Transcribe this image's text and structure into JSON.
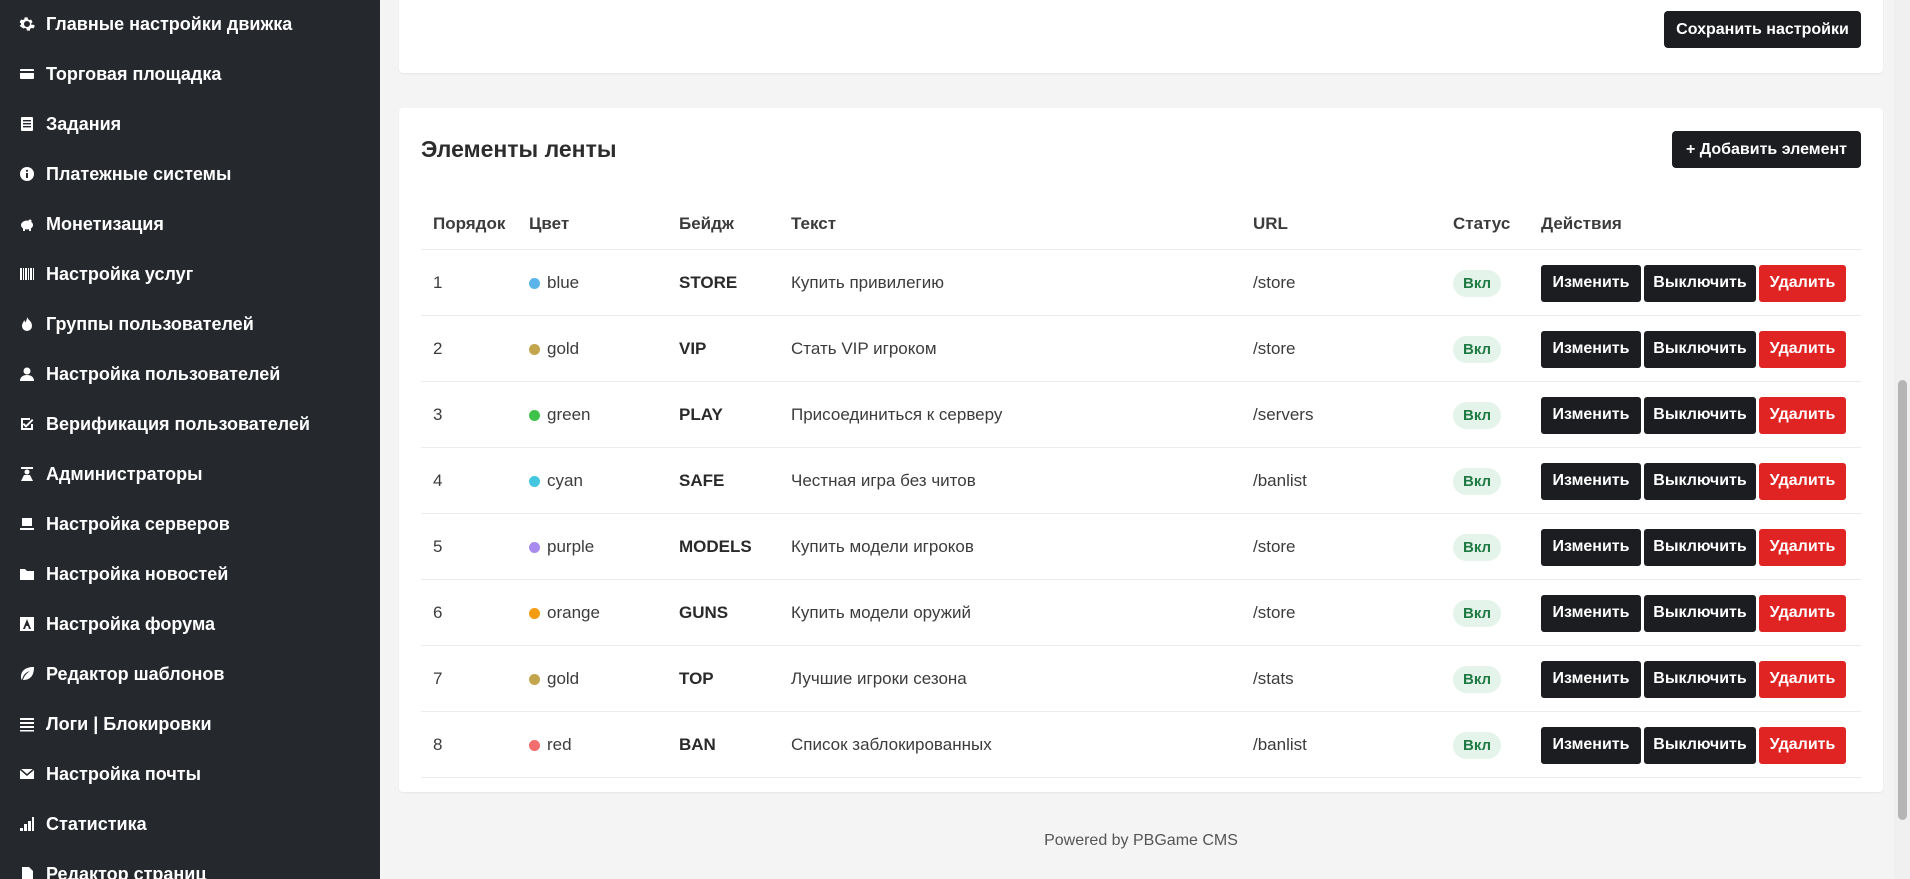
{
  "sidebar": {
    "items": [
      {
        "label": "Главные настройки движка",
        "icon": "gear-icon"
      },
      {
        "label": "Торговая площадка",
        "icon": "card-icon"
      },
      {
        "label": "Задания",
        "icon": "list-icon"
      },
      {
        "label": "Платежные системы",
        "icon": "info-icon"
      },
      {
        "label": "Монетизация",
        "icon": "piggy-bank-icon"
      },
      {
        "label": "Настройка услуг",
        "icon": "barcode-icon"
      },
      {
        "label": "Группы пользователей",
        "icon": "fire-icon"
      },
      {
        "label": "Настройка пользователей",
        "icon": "user-icon"
      },
      {
        "label": "Верификация пользователей",
        "icon": "check-square-icon"
      },
      {
        "label": "Администраторы",
        "icon": "admin-icon"
      },
      {
        "label": "Настройка серверов",
        "icon": "server-icon"
      },
      {
        "label": "Настройка новостей",
        "icon": "folder-icon"
      },
      {
        "label": "Настройка форума",
        "icon": "forum-icon"
      },
      {
        "label": "Редактор шаблонов",
        "icon": "leaf-icon"
      },
      {
        "label": "Логи | Блокировки",
        "icon": "lines-icon"
      },
      {
        "label": "Настройка почты",
        "icon": "envelope-icon"
      },
      {
        "label": "Статистика",
        "icon": "bar-chart-icon"
      },
      {
        "label": "Редактор страниц",
        "icon": "file-icon"
      }
    ]
  },
  "top_card": {
    "save_label": "Сохранить настройки"
  },
  "main_card": {
    "title": "Элементы ленты",
    "add_label": "+ Добавить элемент",
    "columns": [
      "Порядок",
      "Цвет",
      "Бейдж",
      "Текст",
      "URL",
      "Статус",
      "Действия"
    ],
    "rows": [
      {
        "order": "1",
        "color": "blue",
        "color_hex": "#5ab4ea",
        "badge": "STORE",
        "text": "Купить привилегию",
        "url": "/store",
        "status": "Вкл"
      },
      {
        "order": "2",
        "color": "gold",
        "color_hex": "#c3a54e",
        "badge": "VIP",
        "text": "Стать VIP игроком",
        "url": "/store",
        "status": "Вкл"
      },
      {
        "order": "3",
        "color": "green",
        "color_hex": "#3fc24a",
        "badge": "PLAY",
        "text": "Присоединиться к серверу",
        "url": "/servers",
        "status": "Вкл"
      },
      {
        "order": "4",
        "color": "cyan",
        "color_hex": "#45c6e0",
        "badge": "SAFE",
        "text": "Честная игра без читов",
        "url": "/banlist",
        "status": "Вкл"
      },
      {
        "order": "5",
        "color": "purple",
        "color_hex": "#a98bf0",
        "badge": "MODELS",
        "text": "Купить модели игроков",
        "url": "/store",
        "status": "Вкл"
      },
      {
        "order": "6",
        "color": "orange",
        "color_hex": "#f39c12",
        "badge": "GUNS",
        "text": "Купить модели оружий",
        "url": "/store",
        "status": "Вкл"
      },
      {
        "order": "7",
        "color": "gold",
        "color_hex": "#c3a54e",
        "badge": "TOP",
        "text": "Лучшие игроки сезона",
        "url": "/stats",
        "status": "Вкл"
      },
      {
        "order": "8",
        "color": "red",
        "color_hex": "#f26d6d",
        "badge": "BAN",
        "text": "Список заблокированных",
        "url": "/banlist",
        "status": "Вкл"
      }
    ],
    "actions": {
      "edit": "Изменить",
      "disable": "Выключить",
      "delete": "Удалить"
    }
  },
  "footer": {
    "text": "Powered by PBGame CMS"
  },
  "colors": {
    "sidebar_bg": "#25282d",
    "dark_button": "#1c1d20",
    "danger": "#e02424",
    "status_bg": "#e4f4ea",
    "status_text": "#1f7a44"
  }
}
